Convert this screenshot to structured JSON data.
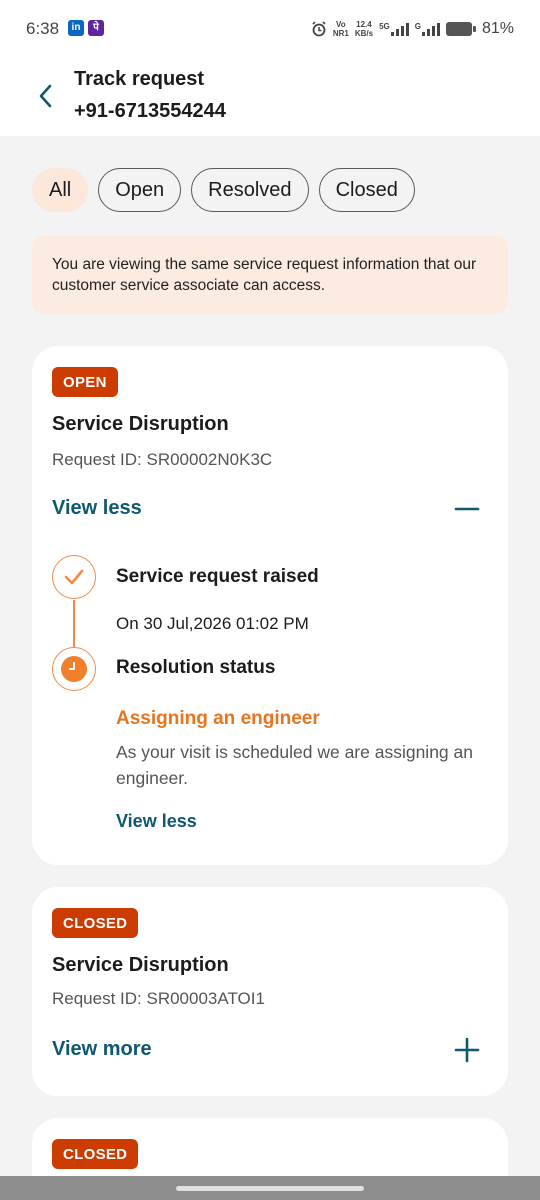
{
  "status_bar": {
    "time": "6:38",
    "app_icon_1": "in",
    "app_icon_2": "पे",
    "net_vo": "Vo",
    "net_nr": "NR1",
    "speed_value": "12.4",
    "speed_unit": "KB/s",
    "net_5g": "5G",
    "net_g": "G",
    "battery": "81%"
  },
  "header": {
    "title": "Track request",
    "phone": "+91-6713554244"
  },
  "filters": {
    "all": "All",
    "open": "Open",
    "resolved": "Resolved",
    "closed": "Closed"
  },
  "notice": "You are viewing the same service request information that our customer service associate can access.",
  "cards": [
    {
      "status": "OPEN",
      "title": "Service Disruption",
      "request_id": "Request ID: SR00002N0K3C",
      "toggle_label": "View less",
      "timeline": {
        "step1_title": "Service request raised",
        "step1_date": "On 30 Jul,2026 01:02 PM",
        "step2_title": "Resolution status",
        "step2_status": "Assigning an engineer",
        "step2_desc": "As your visit is scheduled we are assigning an engineer.",
        "inner_toggle": "View less"
      }
    },
    {
      "status": "CLOSED",
      "title": "Service Disruption",
      "request_id": "Request ID: SR00003ATOI1",
      "toggle_label": "View more"
    },
    {
      "status": "CLOSED"
    }
  ],
  "colors": {
    "accent_orange": "#e8751e",
    "badge_red": "#cc3b00",
    "link_teal": "#0e5870",
    "chip_active_bg": "#fbe8db"
  }
}
